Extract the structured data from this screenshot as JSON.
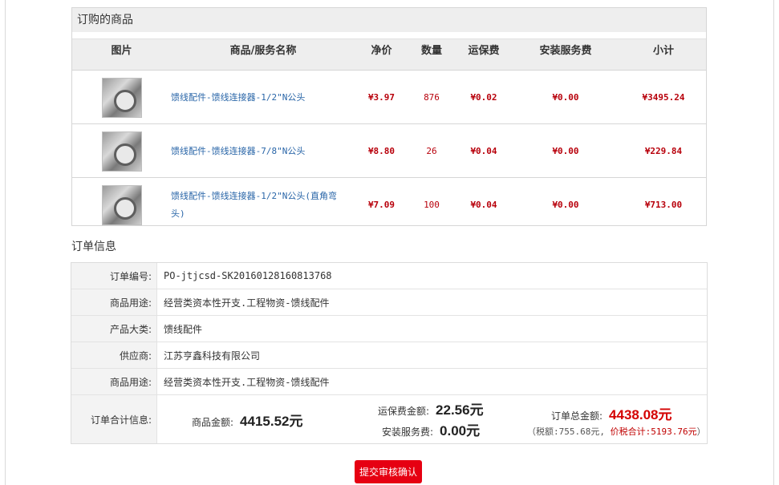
{
  "goods": {
    "title": "订购的商品",
    "headers": [
      "图片",
      "商品/服务名称",
      "净价",
      "数量",
      "运保费",
      "安装服务费",
      "小计"
    ],
    "rows": [
      {
        "name": "馈线配件-馈线连接器-1/2\"N公头",
        "price": "¥3.97",
        "qty": "876",
        "shipping": "¥0.02",
        "install": "¥0.00",
        "subtotal": "¥3495.24"
      },
      {
        "name": "馈线配件-馈线连接器-7/8\"N公头",
        "price": "¥8.80",
        "qty": "26",
        "shipping": "¥0.04",
        "install": "¥0.00",
        "subtotal": "¥229.84"
      },
      {
        "name": "馈线配件-馈线连接器-1/2\"N公头(直角弯头)",
        "price": "¥7.09",
        "qty": "100",
        "shipping": "¥0.04",
        "install": "¥0.00",
        "subtotal": "¥713.00"
      }
    ]
  },
  "order": {
    "heading": "订单信息",
    "rows": [
      {
        "label": "订单编号:",
        "value": "PO-jtjcsd-SK20160128160813768"
      },
      {
        "label": "商品用途:",
        "value": "经营类资本性开支.工程物资-馈线配件"
      },
      {
        "label": "产品大类:",
        "value": "馈线配件"
      },
      {
        "label": "供应商:",
        "value": "江苏亨鑫科技有限公司"
      },
      {
        "label": "商品用途:",
        "value": "经营类资本性开支.工程物资-馈线配件"
      }
    ],
    "summary": {
      "label": "订单合计信息:",
      "goods_amount_label": "商品金额:",
      "goods_amount": "4415.52元",
      "shipping_label": "运保费金额:",
      "shipping_amount": "22.56元",
      "install_label": "安装服务费:",
      "install_amount": "0.00元",
      "total_label": "订单总金额:",
      "total_amount": "4438.08元",
      "tax_open": "（税额:",
      "tax_amount": "755.68元,",
      "tax_total_label": "价税合计:",
      "tax_total": "5193.76元",
      "tax_close": "）"
    }
  },
  "submit_label": "提交审核确认",
  "colors": {
    "accent_red": "#e60012",
    "price_red": "#b8000b",
    "link_blue": "#2a66a8"
  }
}
